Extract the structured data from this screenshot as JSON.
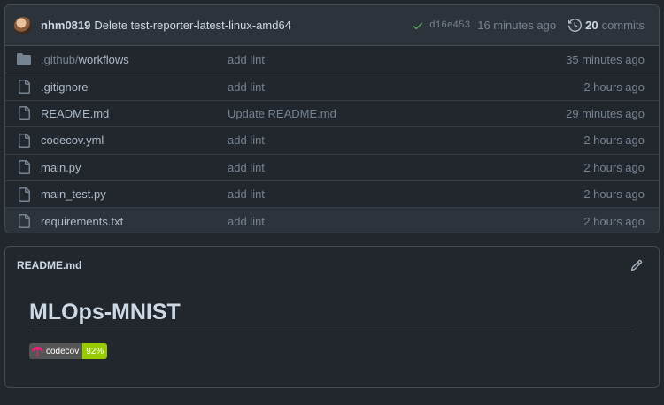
{
  "commit": {
    "author": "nhm0819",
    "message": "Delete test-reporter-latest-linux-amd64",
    "sha": "d16e453",
    "age": "16 minutes ago",
    "count": "20",
    "count_label": "commits"
  },
  "files": [
    {
      "type": "folder",
      "prefix": ".github/",
      "name": "workflows",
      "message": "add lint",
      "age": "35 minutes ago"
    },
    {
      "type": "file",
      "prefix": "",
      "name": ".gitignore",
      "message": "add lint",
      "age": "2 hours ago"
    },
    {
      "type": "file",
      "prefix": "",
      "name": "README.md",
      "message": "Update README.md",
      "age": "29 minutes ago"
    },
    {
      "type": "file",
      "prefix": "",
      "name": "codecov.yml",
      "message": "add lint",
      "age": "2 hours ago"
    },
    {
      "type": "file",
      "prefix": "",
      "name": "main.py",
      "message": "add lint",
      "age": "2 hours ago"
    },
    {
      "type": "file",
      "prefix": "",
      "name": "main_test.py",
      "message": "add lint",
      "age": "2 hours ago"
    },
    {
      "type": "file",
      "prefix": "",
      "name": "requirements.txt",
      "message": "add lint",
      "age": "2 hours ago"
    }
  ],
  "readme": {
    "file_title": "README.md",
    "heading": "MLOps-MNIST",
    "badge": {
      "label": "codecov",
      "value": "92%",
      "value_color": "#97ca00"
    }
  },
  "colors": {
    "background": "#22272e",
    "header": "#2d333b",
    "border": "#444c56",
    "success": "#57ab5a"
  },
  "icons": {
    "avatar": "avatar",
    "check": "check-icon",
    "history": "history-icon",
    "folder": "folder-icon",
    "file": "file-icon",
    "edit": "pencil-icon",
    "codecov": "umbrella-icon"
  }
}
